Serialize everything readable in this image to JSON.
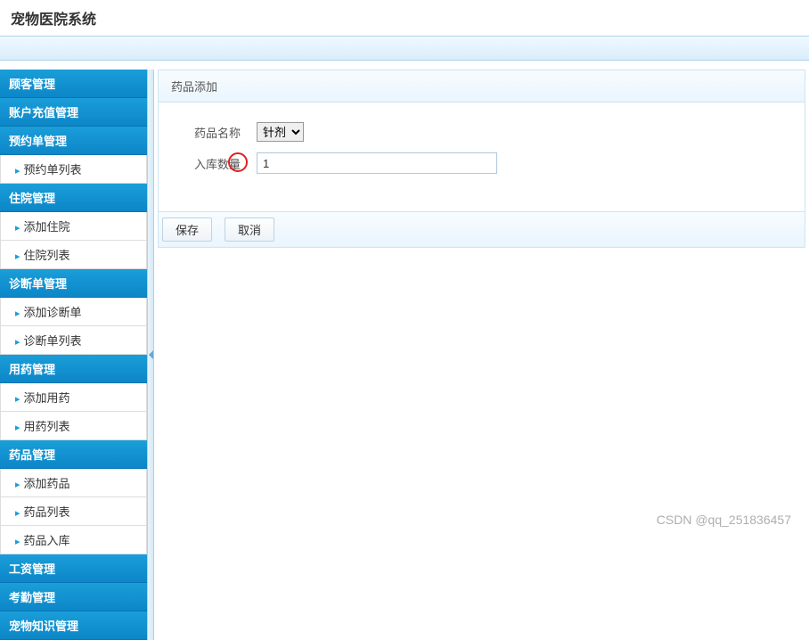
{
  "header": {
    "title": "宠物医院系统"
  },
  "sidebar": {
    "sections": [
      {
        "label": "顾客管理",
        "items": []
      },
      {
        "label": "账户充值管理",
        "items": []
      },
      {
        "label": "预约单管理",
        "items": [
          {
            "label": "预约单列表"
          }
        ]
      },
      {
        "label": "住院管理",
        "items": [
          {
            "label": "添加住院"
          },
          {
            "label": "住院列表"
          }
        ]
      },
      {
        "label": "诊断单管理",
        "items": [
          {
            "label": "添加诊断单"
          },
          {
            "label": "诊断单列表"
          }
        ]
      },
      {
        "label": "用药管理",
        "items": [
          {
            "label": "添加用药"
          },
          {
            "label": "用药列表"
          }
        ]
      },
      {
        "label": "药品管理",
        "items": [
          {
            "label": "添加药品"
          },
          {
            "label": "药品列表"
          },
          {
            "label": "药品入库"
          }
        ]
      },
      {
        "label": "工资管理",
        "items": []
      },
      {
        "label": "考勤管理",
        "items": []
      },
      {
        "label": "宠物知识管理",
        "items": []
      }
    ]
  },
  "panel": {
    "title": "药品添加",
    "fields": {
      "name_label": "药品名称",
      "name_value": "针剂",
      "qty_label": "入库数量",
      "qty_value": "1"
    },
    "buttons": {
      "save": "保存",
      "cancel": "取消"
    }
  },
  "watermark": "CSDN @qq_251836457"
}
